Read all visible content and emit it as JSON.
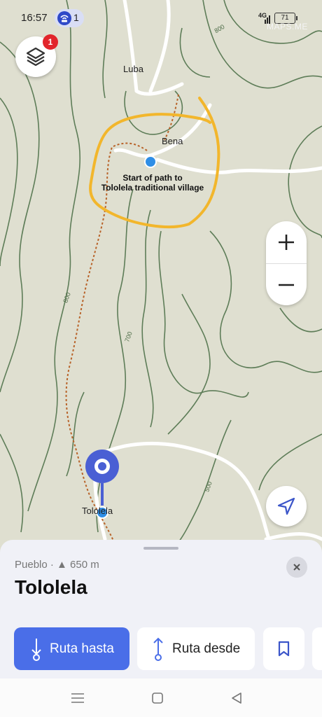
{
  "status_bar": {
    "time": "16:57",
    "hotspot_count": "1",
    "network": "4G",
    "battery": "71"
  },
  "map": {
    "brand": "MAPS.ME",
    "layers_badge": "1",
    "labels": {
      "luba": "Luba",
      "bena": "Bena",
      "tololela": "Tololela",
      "annotation_line1": "Start of path to",
      "annotation_line2": "Tololela traditional village"
    },
    "contours": {
      "c800_top": "800",
      "c800_left": "800",
      "c700": "700",
      "c500": "500"
    },
    "colors": {
      "land": "#dfdfd0",
      "contour": "#5e7d58",
      "trail": "#b8632a",
      "road": "#ffffff",
      "highlight": "#f2b62c",
      "pin": "#4a5fd4",
      "dot": "#2f8ee6"
    }
  },
  "controls": {
    "layers_icon": "layers-icon",
    "zoom_in_icon": "plus-icon",
    "zoom_out_icon": "minus-icon",
    "locate_icon": "navigation-arrow-icon"
  },
  "place_sheet": {
    "subtitle": "Pueblo · ▲ 650 m",
    "title": "Tololela",
    "close_icon": "close-icon",
    "actions": {
      "route_to": "Ruta hasta",
      "route_from": "Ruta desde",
      "save_icon": "bookmark-icon"
    },
    "accent": "#4a6ee8"
  },
  "nav_bar": {
    "menu_icon": "menu-icon",
    "home_icon": "home-square-icon",
    "back_icon": "back-triangle-icon"
  }
}
